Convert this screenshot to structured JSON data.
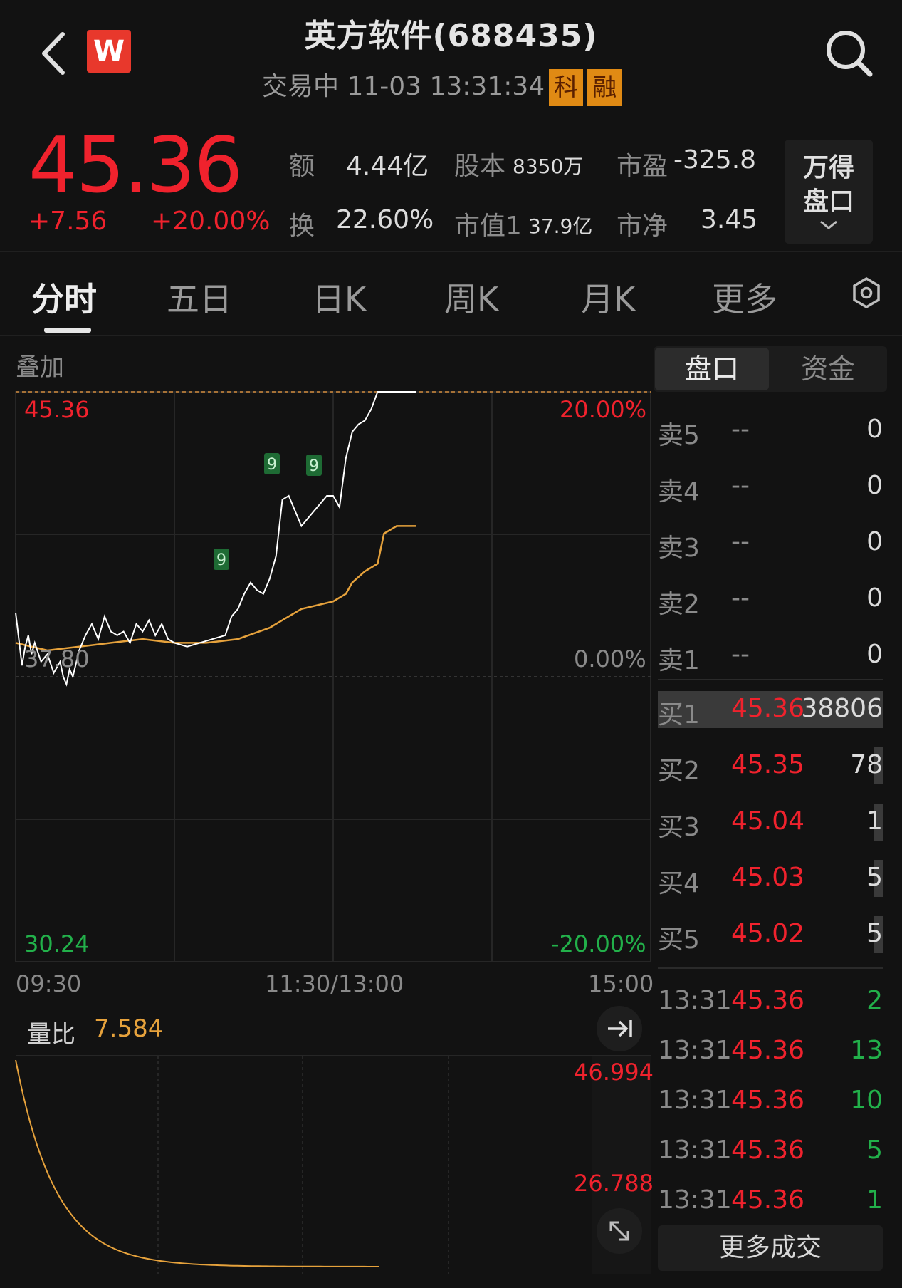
{
  "header": {
    "title": "英方软件(688435)",
    "status": "交易中 11-03 13:31:34",
    "tags": [
      "科",
      "融"
    ],
    "logo_letter": "W"
  },
  "quote": {
    "price": "45.36",
    "change": "+7.56",
    "change_pct": "+20.00%",
    "stats": [
      {
        "label": "额",
        "value": "4.44亿"
      },
      {
        "label": "股本",
        "value": "8350万"
      },
      {
        "label": "市盈",
        "value": "-325.8"
      },
      {
        "label": "换",
        "value": "22.60%"
      },
      {
        "label": "市值1",
        "value": "37.9亿"
      },
      {
        "label": "市净",
        "value": "3.45"
      }
    ],
    "wande_button": [
      "万得",
      "盘口"
    ]
  },
  "tabs": [
    "分时",
    "五日",
    "日K",
    "周K",
    "月K",
    "更多"
  ],
  "chart": {
    "overlay_label": "叠加",
    "price_high": "45.36",
    "price_mid": "37.80",
    "price_low": "30.24",
    "pct_high": "20.00%",
    "pct_mid": "0.00%",
    "pct_low": "-20.00%",
    "time_labels": [
      "09:30",
      "11:30/13:00",
      "15:00"
    ],
    "markers": [
      "9",
      "9",
      "9"
    ],
    "colors": {
      "price_line": "#ffffff",
      "avg_line": "#e6a23c",
      "up": "#f0222d",
      "down": "#22b04a"
    }
  },
  "chart_data": {
    "type": "line",
    "x_label_ticks": [
      "09:30",
      "11:30/13:00",
      "15:00"
    ],
    "ylim": [
      30.24,
      45.36
    ],
    "series": [
      {
        "name": "",
        "points": [
          [
            0,
            39.5
          ],
          [
            0.01,
            38.1
          ],
          [
            0.015,
            38.6
          ],
          [
            0.02,
            38.9
          ],
          [
            0.025,
            38.4
          ],
          [
            0.03,
            38.7
          ],
          [
            0.04,
            38.2
          ],
          [
            0.05,
            38.4
          ],
          [
            0.06,
            37.9
          ],
          [
            0.07,
            38.2
          ],
          [
            0.075,
            37.8
          ],
          [
            0.08,
            37.6
          ],
          [
            0.085,
            38.0
          ],
          [
            0.09,
            37.8
          ],
          [
            0.1,
            38.5
          ],
          [
            0.11,
            38.9
          ],
          [
            0.12,
            39.2
          ],
          [
            0.13,
            38.8
          ],
          [
            0.14,
            39.4
          ],
          [
            0.15,
            39.0
          ],
          [
            0.16,
            38.9
          ],
          [
            0.17,
            39.0
          ],
          [
            0.18,
            38.7
          ],
          [
            0.19,
            39.2
          ],
          [
            0.2,
            39.0
          ],
          [
            0.21,
            39.3
          ],
          [
            0.22,
            38.9
          ],
          [
            0.23,
            39.2
          ],
          [
            0.24,
            38.8
          ],
          [
            0.25,
            38.7
          ],
          [
            0.27,
            38.6
          ],
          [
            0.29,
            38.7
          ],
          [
            0.31,
            38.8
          ],
          [
            0.33,
            38.9
          ],
          [
            0.34,
            39.4
          ],
          [
            0.35,
            39.6
          ],
          [
            0.36,
            40.0
          ],
          [
            0.37,
            40.3
          ],
          [
            0.38,
            40.1
          ],
          [
            0.39,
            40.0
          ],
          [
            0.4,
            40.4
          ],
          [
            0.41,
            41.0
          ],
          [
            0.42,
            42.5
          ],
          [
            0.43,
            42.6
          ],
          [
            0.44,
            42.2
          ],
          [
            0.45,
            41.8
          ],
          [
            0.46,
            42.0
          ],
          [
            0.47,
            42.2
          ],
          [
            0.48,
            42.4
          ],
          [
            0.49,
            42.6
          ],
          [
            0.5,
            42.6
          ],
          [
            0.51,
            42.3
          ],
          [
            0.52,
            43.6
          ],
          [
            0.53,
            44.3
          ],
          [
            0.54,
            44.5
          ],
          [
            0.55,
            44.6
          ],
          [
            0.56,
            44.9
          ],
          [
            0.57,
            45.36
          ],
          [
            0.6,
            45.36
          ],
          [
            0.63,
            45.36
          ]
        ]
      },
      {
        "name": "",
        "points": [
          [
            0,
            38.7
          ],
          [
            0.05,
            38.5
          ],
          [
            0.1,
            38.6
          ],
          [
            0.15,
            38.7
          ],
          [
            0.2,
            38.8
          ],
          [
            0.25,
            38.7
          ],
          [
            0.3,
            38.7
          ],
          [
            0.35,
            38.8
          ],
          [
            0.4,
            39.1
          ],
          [
            0.42,
            39.3
          ],
          [
            0.45,
            39.6
          ],
          [
            0.5,
            39.8
          ],
          [
            0.52,
            40.0
          ],
          [
            0.53,
            40.3
          ],
          [
            0.55,
            40.6
          ],
          [
            0.57,
            40.8
          ],
          [
            0.58,
            41.6
          ],
          [
            0.6,
            41.8
          ],
          [
            0.63,
            41.8
          ]
        ]
      }
    ]
  },
  "order_book": {
    "tabs": [
      "盘口",
      "资金"
    ],
    "sells": [
      {
        "label": "卖5",
        "price": "--",
        "volume": "0"
      },
      {
        "label": "卖4",
        "price": "--",
        "volume": "0"
      },
      {
        "label": "卖3",
        "price": "--",
        "volume": "0"
      },
      {
        "label": "卖2",
        "price": "--",
        "volume": "0"
      },
      {
        "label": "卖1",
        "price": "--",
        "volume": "0"
      }
    ],
    "buys": [
      {
        "label": "买1",
        "price": "45.36",
        "volume": "38806",
        "bar": 1.0
      },
      {
        "label": "买2",
        "price": "45.35",
        "volume": "78",
        "bar": 0.02
      },
      {
        "label": "买3",
        "price": "45.04",
        "volume": "1",
        "bar": 0.02
      },
      {
        "label": "买4",
        "price": "45.03",
        "volume": "5",
        "bar": 0.02
      },
      {
        "label": "买5",
        "price": "45.02",
        "volume": "5",
        "bar": 0.02
      }
    ]
  },
  "ticks": [
    {
      "time": "13:31",
      "price": "45.36",
      "volume": "2"
    },
    {
      "time": "13:31",
      "price": "45.36",
      "volume": "13"
    },
    {
      "time": "13:31",
      "price": "45.36",
      "volume": "10"
    },
    {
      "time": "13:31",
      "price": "45.36",
      "volume": "5"
    },
    {
      "time": "13:31",
      "price": "45.36",
      "volume": "1"
    }
  ],
  "more_trades": "更多成交",
  "volume_ratio": {
    "label": "量比",
    "value": "7.584",
    "high": "46.994",
    "mid": "26.788"
  }
}
